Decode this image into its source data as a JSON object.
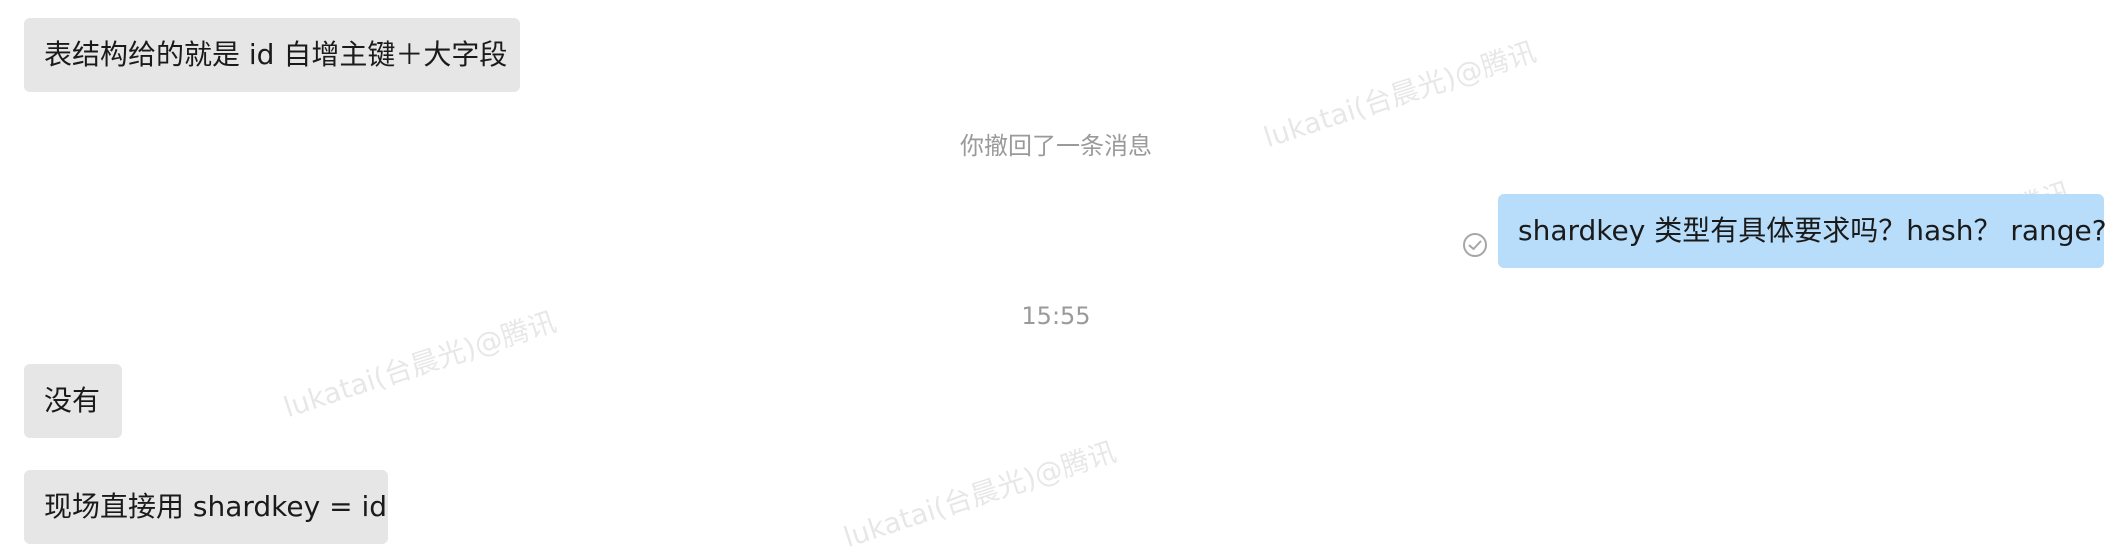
{
  "messages": {
    "m1": "表结构给的就是 id 自增主键＋大字段",
    "recall_notice": "你撤回了一条消息",
    "m2": "shardkey 类型有具体要求吗？hash？ range?",
    "timestamp": "15:55",
    "m3": "没有",
    "m4": "现场直接用 shardkey = id"
  },
  "watermark": {
    "text": "lukatai(台晨光)@腾讯",
    "partial": "腾讯"
  },
  "colors": {
    "incoming_bubble": "#e6e6e6",
    "outgoing_bubble": "#b7ddfa",
    "system_text": "#9a9a9a"
  },
  "icons": {
    "read_status": "check-circle-icon"
  }
}
